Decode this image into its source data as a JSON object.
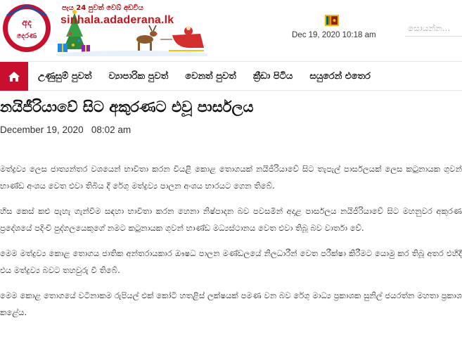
{
  "header": {
    "banner_tagline": "පැය 24 පුවත් වෙබ් අඩවිය",
    "banner_site": "sinhala.adaderana.lk",
    "logo_text": "අද දෙරණ",
    "date_time": "Dec 19, 2020 10:18 am",
    "search_placeholder": "සොයන්න...",
    "flag_icon": "sri-lanka-flag-icon"
  },
  "nav": {
    "home_icon": "home-icon",
    "items": [
      {
        "label": "උණුසුම් පුවත්"
      },
      {
        "label": "ව්‍යාපාරික පුවත්"
      },
      {
        "label": "වෙනත් පුවත්"
      },
      {
        "label": "ක්‍රීඩා පිටිය"
      },
      {
        "label": "සයුරෙන් එතෙර"
      }
    ]
  },
  "article": {
    "headline": "නයිජීරියාවේ සිට අකුරණට එවූ පාර්සලය",
    "date": "December 19, 2020",
    "time": "08:02 am",
    "paragraphs": [
      "මත්ද්‍රව්‍ය ලෙස ජාත්‍යන්තර වශයෙන් භාවිතා කරන වියළි කොළ තොගයක් නයිජීරියාවේ සිට තැපැල් පාර්සලයක් ලෙස කටුනායක ගුවන් භාණ්ඩ අංශය වෙත එවා තිබිය දී රේගු මත්ද්‍රව්‍ය පාලන අංශය භාරයට ගෙන තිබේ.",
      "හිස කෙස් කළු පැහැ ගැන්වීම සඳහා භාවිතා කරන හෙනා නිෂ්පාදන බව පවසමින් අදාළ පාර්සලය නයිජීරියාවේ සිට මහනුවර අකුරණ ප්‍රදේශයේ පදිංචි පුද්ගලයෙකුගේ නමට කටුනායක ගුවන් භාණ්ඩ මධ්‍යස්ථානය වෙත එවා තිබූ බව වාර්තා වේ.",
      "මෙම මත්ද්‍රව්‍ය කොළ තොගය ජාතික අන්තරායකාර ඖෂධ පාලන මණ්ඩලයේ නිලධාරීන් වෙත පරීක්ෂා කිරීමට යොමු කර තිබූ අතර එහිදී එය මත්ද්‍රව්‍ය බවට තහවුරු වී තිබේ.",
      "මෙම කොළ තොගයේ වටිනාකම රුපියල් එක් කෝටි හතළිස් ලක්ෂයක් පමණ වන බව රේගු මාධ්‍ය ප්‍රකාශක සුනිල් ජයරත්න මහතා ප්‍රකාශ කළේය."
    ]
  },
  "colors": {
    "brand_red": "#c8102e",
    "site_text_red": "#c3161c"
  }
}
